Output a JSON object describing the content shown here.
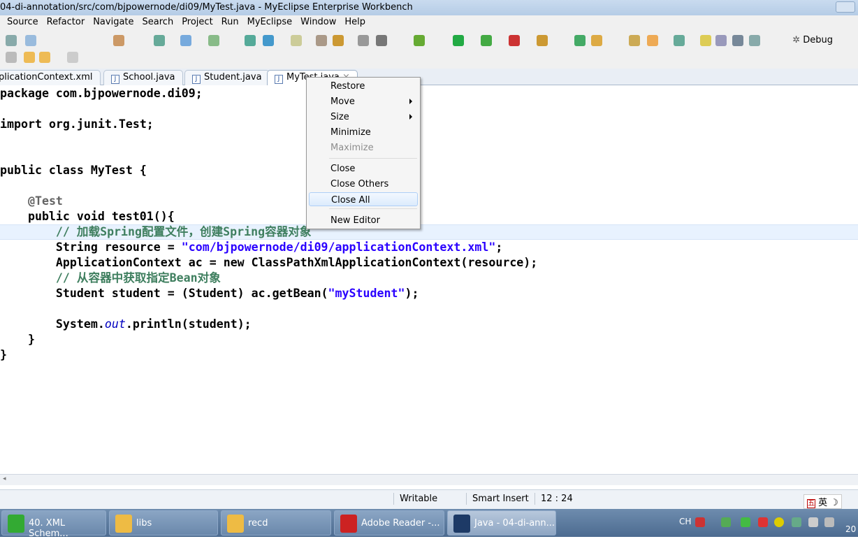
{
  "window": {
    "title": "04-di-annotation/src/com/bjpowernode/di09/MyTest.java - MyEclipse Enterprise Workbench"
  },
  "menu": [
    "Source",
    "Refactor",
    "Navigate",
    "Search",
    "Project",
    "Run",
    "MyEclipse",
    "Window",
    "Help"
  ],
  "toolbar": {
    "perspective_label": "Debug"
  },
  "tabs": [
    "plicationContext.xml",
    "School.java",
    "Student.java",
    "MyTest.java"
  ],
  "code": [
    {
      "n": 1,
      "t": [
        [
          "package",
          "kw"
        ],
        [
          " com.bjpowernode.di09;",
          "pl"
        ]
      ]
    },
    {
      "n": 3,
      "t": [
        [
          "import",
          "kw"
        ],
        [
          " org.junit.Test;",
          "pl"
        ]
      ]
    },
    {
      "n": 6,
      "t": [
        [
          "public class",
          "kw"
        ],
        [
          " MyTest {",
          "pl"
        ]
      ]
    },
    {
      "n": 8,
      "t": [
        [
          "    ",
          "pl"
        ],
        [
          "@Test",
          "an"
        ]
      ]
    },
    {
      "n": 9,
      "t": [
        [
          "    public void",
          "kw"
        ],
        [
          " test01(){",
          "pl"
        ]
      ]
    },
    {
      "n": 10,
      "t": [
        [
          "        // 加载Spring配置文件，创建Spring容器对象",
          "cm"
        ]
      ]
    },
    {
      "n": 11,
      "t": [
        [
          "        String resource = ",
          "pl"
        ],
        [
          "\"com/bjpowernode/di09/applicationContext.xml\"",
          "st"
        ],
        [
          ";",
          "pl"
        ]
      ]
    },
    {
      "n": 12,
      "t": [
        [
          "        ApplicationContext ac = ",
          "pl"
        ],
        [
          "new",
          "kw"
        ],
        [
          " ClassPathXmlApplicationContext(resource);",
          "pl"
        ]
      ]
    },
    {
      "n": 13,
      "t": [
        [
          "        // 从容器中获取指定Bean对象",
          "cm"
        ]
      ]
    },
    {
      "n": 14,
      "t": [
        [
          "        Student student = (Student) ac.getBean(",
          "pl"
        ],
        [
          "\"myStudent\"",
          "st"
        ],
        [
          ");",
          "pl"
        ]
      ]
    },
    {
      "n": 16,
      "t": [
        [
          "        System.",
          "pl"
        ],
        [
          "out",
          "it"
        ],
        [
          ".println(student);",
          "pl"
        ]
      ]
    },
    {
      "n": 17,
      "t": [
        [
          "    }",
          "pl"
        ]
      ]
    },
    {
      "n": 18,
      "t": [
        [
          "}",
          "pl"
        ]
      ]
    }
  ],
  "context_menu": [
    {
      "label": "Restore",
      "enabled": true
    },
    {
      "label": "Move",
      "enabled": true,
      "submenu": true
    },
    {
      "label": "Size",
      "enabled": true,
      "submenu": true
    },
    {
      "label": "Minimize",
      "enabled": true
    },
    {
      "label": "Maximize",
      "enabled": false
    },
    {
      "label": "Close",
      "enabled": true
    },
    {
      "label": "Close Others",
      "enabled": true
    },
    {
      "label": "Close All",
      "enabled": true,
      "highlighted": true
    },
    {
      "label": "New Editor",
      "enabled": true
    }
  ],
  "status": {
    "writable": "Writable",
    "insert_mode": "Smart Insert",
    "position": "12 : 24"
  },
  "ime": {
    "mode1": "五",
    "mode2": "英"
  },
  "taskbar": {
    "items": [
      "40. XML Schem...",
      "libs",
      "recd",
      "Adobe Reader -...",
      "Java - 04-di-ann..."
    ],
    "lang": "CH",
    "clock": "20"
  }
}
